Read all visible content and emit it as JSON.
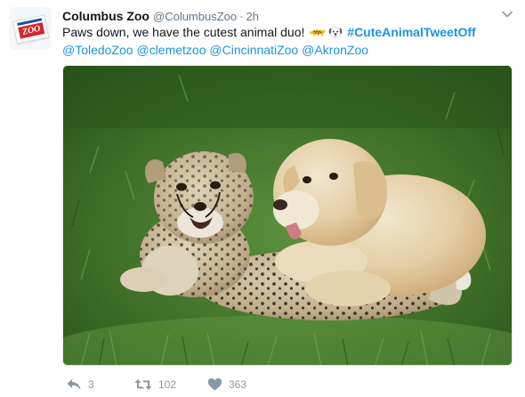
{
  "tweet": {
    "author_name": "Columbus Zoo",
    "author_handle": "@ColumbusZoo",
    "separator": "·",
    "time": "2h",
    "text_intro": "Paws down, we have the cutest animal duo! ",
    "hashtag": "#CuteAnimalTweetOff",
    "mentions": [
      "@ToledoZoo",
      "@clemetzoo",
      "@CincinnatiZoo",
      "@AkronZoo"
    ],
    "emojis": [
      "leopard-emoji",
      "dog-face-emoji"
    ],
    "avatar_logo_text": "ZOO"
  },
  "actions": {
    "reply_count": "3",
    "retweet_count": "102",
    "like_count": "363"
  },
  "colors": {
    "link": "#1b95e0",
    "meta": "#657786",
    "action": "#8899a6",
    "logo_red": "#d5262f"
  }
}
